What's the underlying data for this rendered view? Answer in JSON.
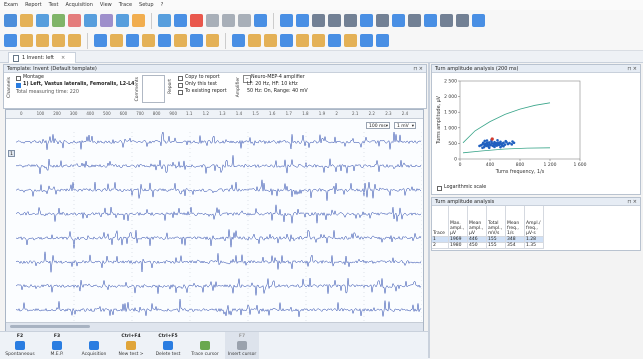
{
  "menu": [
    "Exam",
    "Report",
    "Test",
    "Acquisition",
    "View",
    "Trace",
    "Setup",
    "?"
  ],
  "toolbar": {
    "row1_colors": [
      "#2e7bd6",
      "#e0a53a",
      "#3b8ed8",
      "#6aa84f",
      "#e06666",
      "#3b8ed8",
      "#8e7cc3",
      "#3b8ed8",
      "#f0a030",
      "#3b8ed8",
      "#2a7de1",
      "#e63b2e",
      "#9aa2ad",
      "#9aa2ad",
      "#9aa2ad",
      "#2a7de1",
      "#2a7de1",
      "#2a7de1",
      "#5b6b82",
      "#5b6b82",
      "#5b6b82",
      "#2a7de1",
      "#5b6b82",
      "#2a7de1",
      "#5b6b82",
      "#2a7de1",
      "#5b6b82",
      "#5b6b82",
      "#2a7de1"
    ],
    "row2_colors": [
      "#2a7de1",
      "#e0a53a",
      "#e0a53a",
      "#e0a53a",
      "#e0a53a",
      "#2a7de1",
      "#e0a53a",
      "#2a7de1",
      "#e0a53a",
      "#2a7de1",
      "#e0a53a",
      "#2a7de1",
      "#e0a53a",
      "#2a7de1",
      "#e0a53a",
      "#e0a53a",
      "#2a7de1",
      "#e0a53a",
      "#e0a53a",
      "#2a7de1",
      "#e0a53a",
      "#2a7de1",
      "#2a7de1"
    ]
  },
  "doc_tab": {
    "label": "1 Invent: left"
  },
  "template": {
    "header": "Template: Invent (Default template)",
    "channels_label": "Channels",
    "montage_label": "Montage",
    "montage_value": "1) Left, Vastus lateralis, Femoralis, L2-L4",
    "total_time": "Total measuring time: 220",
    "comments_label": "Comments",
    "report_label": "Report",
    "copy_to_report": "Copy to report",
    "only_this_test": "Only this test",
    "to_existing_report": "To existing report",
    "amplifier_label": "Amplifier",
    "amplifier_title": "Neuro-MEP-4 amplifier",
    "amplifier_filters": "LF: 20 Hz, HF: 10 kHz",
    "amplifier_extra": "50 Hz: On, Range: 40 mV"
  },
  "wave": {
    "ruler": [
      "0",
      "100",
      "200",
      "300",
      "400",
      "500",
      "600",
      "700",
      "800",
      "900",
      "1.1",
      "1.2",
      "1.3",
      "1.4",
      "1.5",
      "1.6",
      "1.7",
      "1.8",
      "1.9",
      "2",
      "2.1",
      "2.2",
      "2.3",
      "2.4"
    ],
    "sweep": "100 ms",
    "sens": "1 mV",
    "trace_label": "1",
    "trace_color": "#1f3fa8"
  },
  "chart_panel": {
    "header": "Turn amplitude analysis (200 ms)",
    "log_label": "Logarithmic scale"
  },
  "chart_data": {
    "type": "scatter",
    "title": "",
    "xlabel": "Turns frequency, 1/s",
    "ylabel": "Turns amplitude, μV",
    "xlim": [
      0,
      1600
    ],
    "ylim": [
      0,
      2500
    ],
    "x_ticks": [
      "0",
      "400",
      "800",
      "1 200",
      "1 600"
    ],
    "y_ticks": [
      "0",
      "500",
      "1 000",
      "1 500",
      "2 000",
      "2 500"
    ],
    "points": [
      [
        260,
        420
      ],
      [
        280,
        440
      ],
      [
        300,
        470
      ],
      [
        310,
        520
      ],
      [
        320,
        380
      ],
      [
        330,
        450
      ],
      [
        340,
        490
      ],
      [
        350,
        420
      ],
      [
        360,
        510
      ],
      [
        370,
        460
      ],
      [
        380,
        400
      ],
      [
        390,
        530
      ],
      [
        400,
        470
      ],
      [
        410,
        440
      ],
      [
        420,
        560
      ],
      [
        430,
        500
      ],
      [
        440,
        420
      ],
      [
        450,
        480
      ],
      [
        460,
        540
      ],
      [
        470,
        460
      ],
      [
        480,
        510
      ],
      [
        490,
        430
      ],
      [
        500,
        470
      ],
      [
        510,
        520
      ],
      [
        520,
        450
      ],
      [
        530,
        490
      ],
      [
        540,
        550
      ],
      [
        550,
        470
      ],
      [
        560,
        430
      ],
      [
        570,
        500
      ],
      [
        580,
        520
      ],
      [
        600,
        460
      ],
      [
        620,
        540
      ],
      [
        640,
        480
      ],
      [
        660,
        510
      ],
      [
        690,
        470
      ],
      [
        720,
        520
      ],
      [
        360,
        590
      ],
      [
        420,
        610
      ],
      [
        500,
        600
      ],
      [
        540,
        380
      ],
      [
        300,
        360
      ],
      [
        460,
        390
      ],
      [
        580,
        410
      ],
      [
        610,
        570
      ],
      [
        700,
        560
      ],
      [
        330,
        580
      ],
      [
        390,
        360
      ]
    ],
    "highlight": [
      [
        430,
        640
      ]
    ],
    "envelope_upper": [
      [
        40,
        520
      ],
      [
        200,
        900
      ],
      [
        400,
        1200
      ],
      [
        600,
        1430
      ],
      [
        800,
        1600
      ],
      [
        1000,
        1720
      ],
      [
        1200,
        1800
      ]
    ],
    "envelope_lower": [
      [
        40,
        200
      ],
      [
        300,
        260
      ],
      [
        600,
        320
      ],
      [
        900,
        350
      ],
      [
        1200,
        360
      ]
    ],
    "grid": false
  },
  "table_panel": {
    "header": "Turn amplitude analysis",
    "columns": [
      "Trace",
      "Max. ampl., μV",
      "Mean ampl., μV",
      "Total ampl., mV/s",
      "Mean freq., 1/s",
      "Ampl./ freq., μV·s"
    ],
    "rows": [
      [
        "1",
        "1969",
        "446",
        "155",
        "348",
        "1.28"
      ],
      [
        "2",
        "1980",
        "450",
        "155",
        "354",
        "1.35"
      ]
    ]
  },
  "fkeys": [
    {
      "key": "F2",
      "label": "Spontaneous",
      "color": "#2a7de1"
    },
    {
      "key": "F3",
      "label": "M.E.P.",
      "color": "#2a7de1"
    },
    {
      "key": "",
      "label": "Acquisition",
      "color": "#2a7de1"
    },
    {
      "key": "Ctrl+F4",
      "label": "New test >",
      "color": "#e0a53a"
    },
    {
      "key": "Ctrl+F5",
      "label": "Delete test",
      "color": "#2a7de1"
    },
    {
      "key": "",
      "label": "Trace cursor",
      "color": "#6aa84f"
    },
    {
      "key": "F7",
      "label": "Insert cursor",
      "color": "#9aa2ad"
    }
  ]
}
